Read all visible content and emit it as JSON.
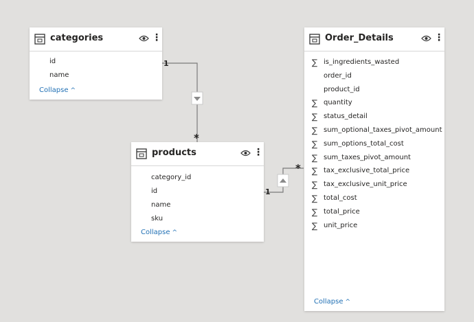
{
  "tables": {
    "categories": {
      "title": "categories",
      "fields": [
        {
          "name": "id",
          "aggregate": false
        },
        {
          "name": "name",
          "aggregate": false
        }
      ],
      "collapse_label": "Collapse"
    },
    "products": {
      "title": "products",
      "fields": [
        {
          "name": "category_id",
          "aggregate": false
        },
        {
          "name": "id",
          "aggregate": false
        },
        {
          "name": "name",
          "aggregate": false
        },
        {
          "name": "sku",
          "aggregate": false
        }
      ],
      "collapse_label": "Collapse"
    },
    "order_details": {
      "title": "Order_Details",
      "fields": [
        {
          "name": "is_ingredients_wasted",
          "aggregate": true
        },
        {
          "name": "order_id",
          "aggregate": false
        },
        {
          "name": "product_id",
          "aggregate": false
        },
        {
          "name": "quantity",
          "aggregate": true
        },
        {
          "name": "status_detail",
          "aggregate": true
        },
        {
          "name": "sum_optional_taxes_pivot_amount",
          "aggregate": true
        },
        {
          "name": "sum_options_total_cost",
          "aggregate": true
        },
        {
          "name": "sum_taxes_pivot_amount",
          "aggregate": true
        },
        {
          "name": "tax_exclusive_total_price",
          "aggregate": true
        },
        {
          "name": "tax_exclusive_unit_price",
          "aggregate": true
        },
        {
          "name": "total_cost",
          "aggregate": true
        },
        {
          "name": "total_price",
          "aggregate": true
        },
        {
          "name": "unit_price",
          "aggregate": true
        }
      ],
      "collapse_label": "Collapse"
    }
  },
  "relationships": [
    {
      "from": "categories",
      "to": "products",
      "from_cardinality": "1",
      "to_cardinality": "*",
      "filter_direction": "down"
    },
    {
      "from": "products",
      "to": "Order_Details",
      "from_cardinality": "1",
      "to_cardinality": "*",
      "filter_direction": "up"
    }
  ],
  "icons": {
    "table": "table-icon",
    "visibility": "eye-icon",
    "more": "more-options-icon",
    "aggregate": "sigma-icon",
    "collapse": "chevron-up-icon",
    "filter": "filter-direction-arrow-icon"
  },
  "colors": {
    "canvas": "#e1e0de",
    "card": "#ffffff",
    "link": "#1f6fb4",
    "line": "#7a7a7a"
  },
  "glyphs": {
    "sigma": "∑",
    "more": "⋮",
    "chevron_up": "^"
  }
}
